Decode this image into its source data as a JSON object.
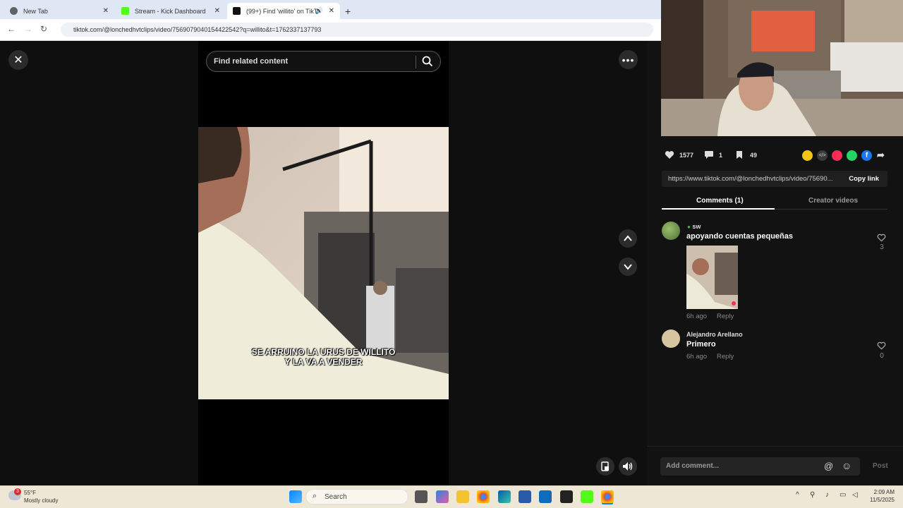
{
  "browser": {
    "tabs": [
      {
        "label": "New Tab",
        "active": false,
        "favicon_color": "#5f6368"
      },
      {
        "label": "Stream - Kick Dashboard",
        "active": false,
        "favicon_color": "#53fc18"
      },
      {
        "label": "(99+) Find 'willito' on TikTol",
        "active": true,
        "favicon_color": "#111111"
      }
    ],
    "url": "tiktok.com/@lonchedhvtclips/video/7569079040154422542?q=willito&t=1762337137793"
  },
  "search": {
    "placeholder": "Find related content"
  },
  "video": {
    "caption_line1": "SE ARRUINO LA URUS DE WILLITO",
    "caption_line2": "Y LA VA A VENDER"
  },
  "stats": {
    "likes": "1577",
    "comments": "1",
    "saves": "49"
  },
  "share_icons": [
    {
      "name": "friends-share-icon",
      "color": "#f5c518"
    },
    {
      "name": "embed-icon",
      "color": "#3a3a3a"
    },
    {
      "name": "send-icon",
      "color": "#fe2c55"
    },
    {
      "name": "whatsapp-icon",
      "color": "#25d366"
    },
    {
      "name": "facebook-icon",
      "color": "#1877f2"
    }
  ],
  "link": {
    "url": "https://www.tiktok.com/@lonchedhvtclips/video/75690...",
    "copy_label": "Copy link"
  },
  "panel_tabs": {
    "comments": "Comments (1)",
    "creator": "Creator videos"
  },
  "comments": [
    {
      "user": "sw",
      "text": "apoyando cuentas pequeñas",
      "time": "6h ago",
      "reply": "Reply",
      "likes": "3"
    },
    {
      "user": "Alejandro Arellano",
      "text": "Primero",
      "time": "6h ago",
      "reply": "Reply",
      "likes": "0"
    }
  ],
  "comment_bar": {
    "placeholder": "Add comment...",
    "post": "Post"
  },
  "taskbar": {
    "weather_temp": "55°F",
    "weather_desc": "Mostly cloudy",
    "weather_badge": "3",
    "search": "Search",
    "time": "2:09 AM",
    "date": "11/5/2025"
  }
}
